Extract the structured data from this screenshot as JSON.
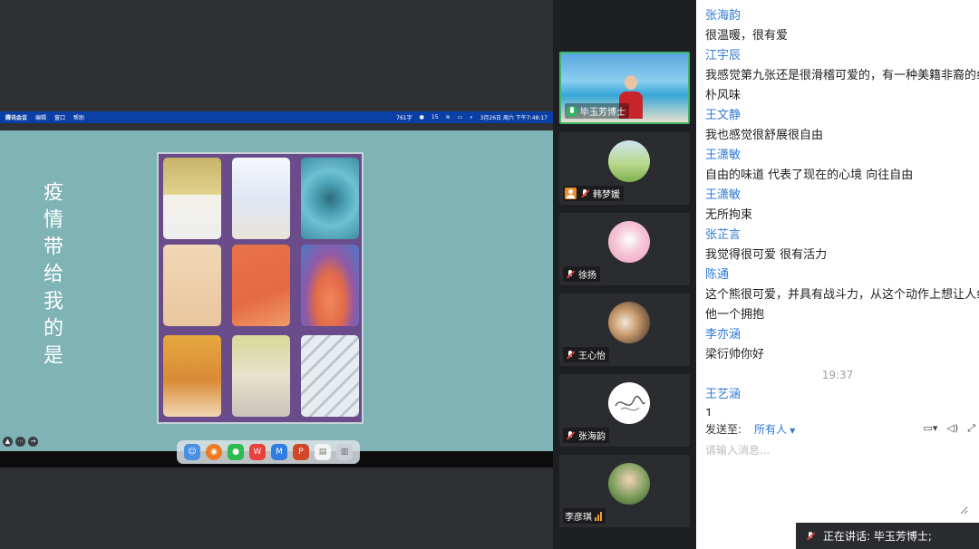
{
  "menubar": {
    "app": "腾讯会议",
    "items": [
      "编辑",
      "窗口",
      "帮助"
    ],
    "status_words": "761字",
    "status_wechat": "15",
    "clock": "3月26日 周六 下午7:48:17"
  },
  "slide": {
    "title": "疫情带给我的是"
  },
  "participants": [
    {
      "name": "毕玉芳博士",
      "mic": "on"
    },
    {
      "name": "韩梦媛",
      "mic": "muted"
    },
    {
      "name": "徐扬",
      "mic": "muted"
    },
    {
      "name": "王心怡",
      "mic": "muted"
    },
    {
      "name": "张海韵",
      "mic": "muted"
    },
    {
      "name": "李彦琪",
      "mic": "on"
    }
  ],
  "chat": {
    "messages": [
      {
        "name": "张海韵",
        "text": "很温暖，很有爱"
      },
      {
        "name": "江宇辰",
        "text": "我感觉第九张还是很滑稽可爱的，有一种美籍非裔的纟朴风味"
      },
      {
        "name": "王文静",
        "text": "我也感觉很舒展很自由"
      },
      {
        "name": "王潇敏",
        "text": "自由的味道 代表了现在的心境 向往自由"
      },
      {
        "name": "王潇敏",
        "text": "无所拘束"
      },
      {
        "name": "张芷言",
        "text": "我觉得很可爱 很有活力"
      },
      {
        "name": "陈通",
        "text": "这个熊很可爱，并具有战斗力，从这个动作上想让人纟他一个拥抱"
      },
      {
        "name": "李亦涵",
        "text": "梁衍帅你好"
      }
    ],
    "timestamp": "19:37",
    "last_message": {
      "name": "王艺涵",
      "text": "1"
    },
    "send_label": "发送至:",
    "send_target": "所有人",
    "input_placeholder": "请输入消息..."
  },
  "speaking": {
    "label": "正在讲话: 毕玉芳博士;"
  }
}
